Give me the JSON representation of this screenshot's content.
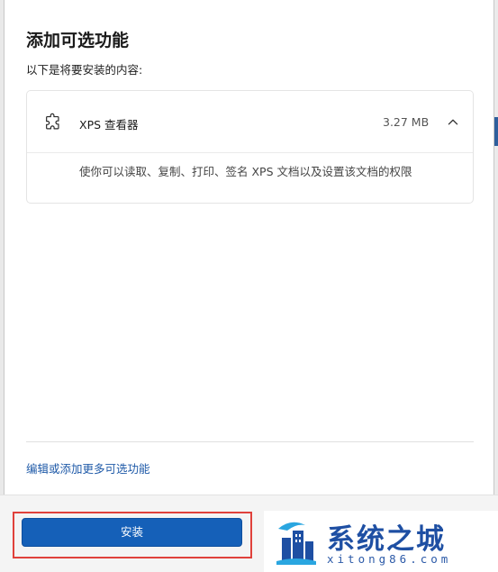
{
  "dialog": {
    "title": "添加可选功能",
    "subtitle": "以下是将要安装的内容:"
  },
  "feature": {
    "icon": "puzzle-icon",
    "name": "XPS 查看器",
    "size": "3.27 MB",
    "expanded": true,
    "description": "使你可以读取、复制、打印、签名 XPS 文档以及设置该文档的权限"
  },
  "link": {
    "label": "编辑或添加更多可选功能"
  },
  "footer": {
    "install_label": "安装"
  },
  "watermark": {
    "title": "系统之城",
    "site": "xitong86.com"
  },
  "colors": {
    "accent": "#1560b8",
    "link": "#1f5aa8",
    "highlight": "#e0413b"
  }
}
